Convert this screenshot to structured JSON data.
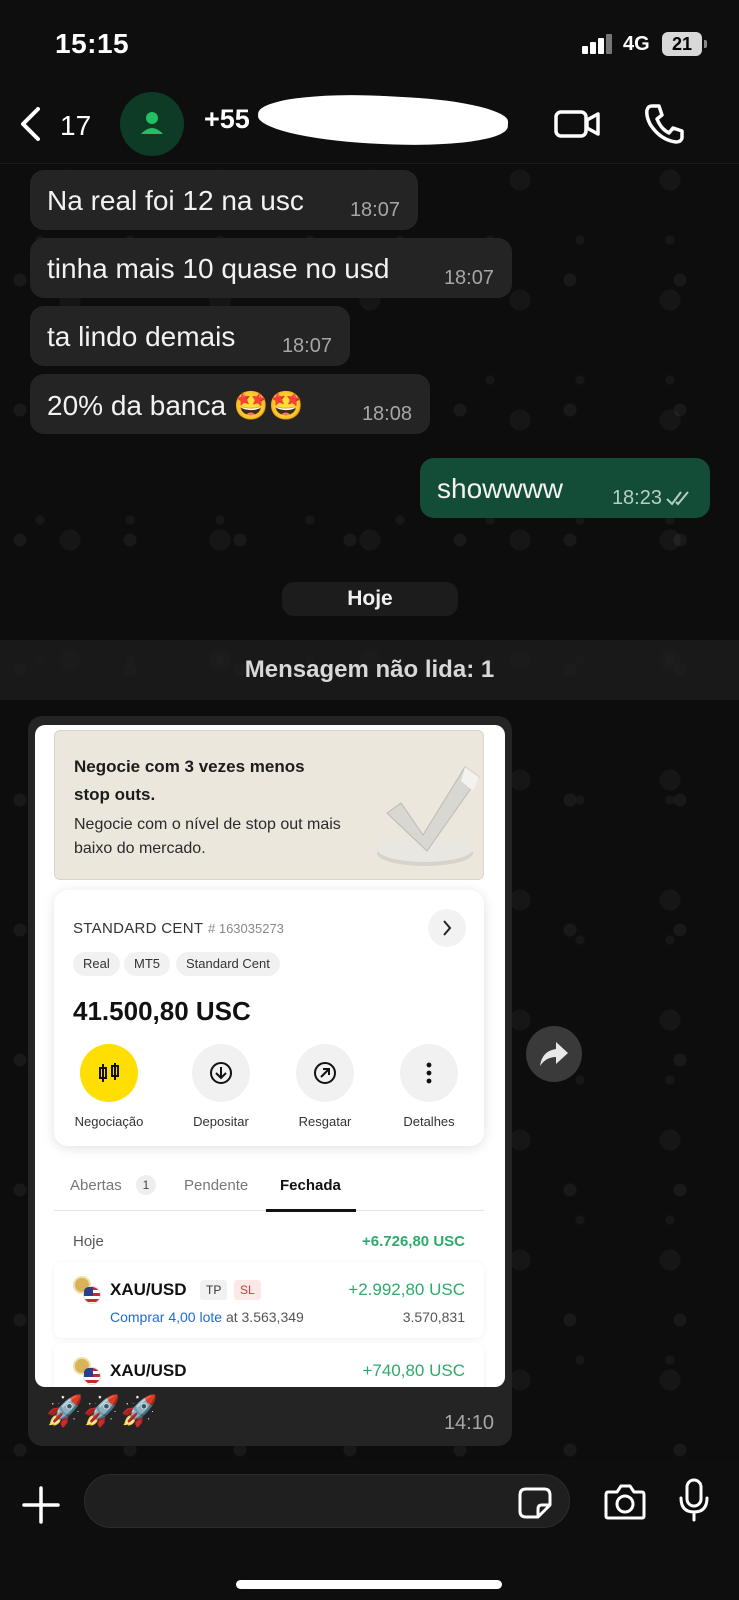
{
  "status_bar": {
    "time": "15:15",
    "network": "4G",
    "battery": "21"
  },
  "header": {
    "back_count": "17",
    "contact": "+55"
  },
  "messages": [
    {
      "text": "Na real foi 12 na usc",
      "time": "18:07"
    },
    {
      "text": "tinha mais 10 quase no usd",
      "time": "18:07"
    },
    {
      "text": "ta lindo demais",
      "time": "18:07"
    },
    {
      "text": "20% da banca 🤩🤩",
      "time": "18:08"
    }
  ],
  "sent": {
    "text": "showwww",
    "time": "18:23",
    "status": "read"
  },
  "day_separator": "Hoje",
  "unread_banner": "Mensagem não lida: 1",
  "screenshot": {
    "promo": {
      "title": "Negocie com 3 vezes menos stop outs.",
      "body": "Negocie com o nível de stop out mais baixo do mercado."
    },
    "account": {
      "name": "STANDARD CENT",
      "number": "# 163035273",
      "tags": [
        "Real",
        "MT5",
        "Standard Cent"
      ],
      "balance": "41.500,80 USC",
      "actions": [
        "Negociação",
        "Depositar",
        "Resgatar",
        "Detalhes"
      ]
    },
    "tabs": {
      "open": "Abertas",
      "open_count": "1",
      "pending": "Pendente",
      "closed": "Fechada"
    },
    "day": {
      "label": "Hoje",
      "total": "+6.726,80 USC"
    },
    "trades": [
      {
        "symbol": "XAU/USD",
        "tp": "TP",
        "sl": "SL",
        "pnl": "+2.992,80 USC",
        "side": "Comprar 4,00 lote",
        "open": "at 3.563,349",
        "close": "3.570,831"
      },
      {
        "symbol": "XAU/USD",
        "pnl": "+740,80 USC"
      }
    ]
  },
  "image_caption": "🚀🚀🚀",
  "image_time": "14:10",
  "colors": {
    "incoming": "#242424",
    "outgoing": "#144d37",
    "accent_yellow": "#ffde02",
    "profit_green": "#2eab6b"
  },
  "icons": [
    "chevron-left-icon",
    "person-icon",
    "video-icon",
    "phone-icon",
    "forward-icon",
    "plus-icon",
    "sticker-icon",
    "camera-icon",
    "mic-icon",
    "double-check-icon"
  ]
}
